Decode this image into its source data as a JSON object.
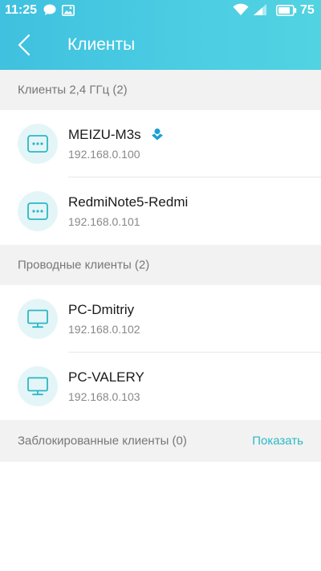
{
  "statusbar": {
    "time": "11:25",
    "battery_level": "75"
  },
  "header": {
    "title": "Клиенты"
  },
  "sections": [
    {
      "title": "Клиенты 2,4 ГГц (2)",
      "items": [
        {
          "name": "MEIZU-M3s",
          "ip": "192.168.0.100",
          "icon": "wireless-device-icon",
          "badge": "user-icon"
        },
        {
          "name": "RedmiNote5-Redmi",
          "ip": "192.168.0.101",
          "icon": "wireless-device-icon"
        }
      ]
    },
    {
      "title": "Проводные клиенты (2)",
      "items": [
        {
          "name": "PC-Dmitriy",
          "ip": "192.168.0.102",
          "icon": "monitor-icon"
        },
        {
          "name": "PC-VALERY",
          "ip": "192.168.0.103",
          "icon": "monitor-icon"
        }
      ]
    },
    {
      "title": "Заблокированные клиенты (0)",
      "action": "Показать"
    }
  ],
  "colors": {
    "header_gradient_start": "#3fc1df",
    "header_gradient_end": "#52d3e2",
    "accent": "#2bb8c4",
    "icon_background": "#e4f5f8",
    "badge": "#1a9fd6"
  }
}
